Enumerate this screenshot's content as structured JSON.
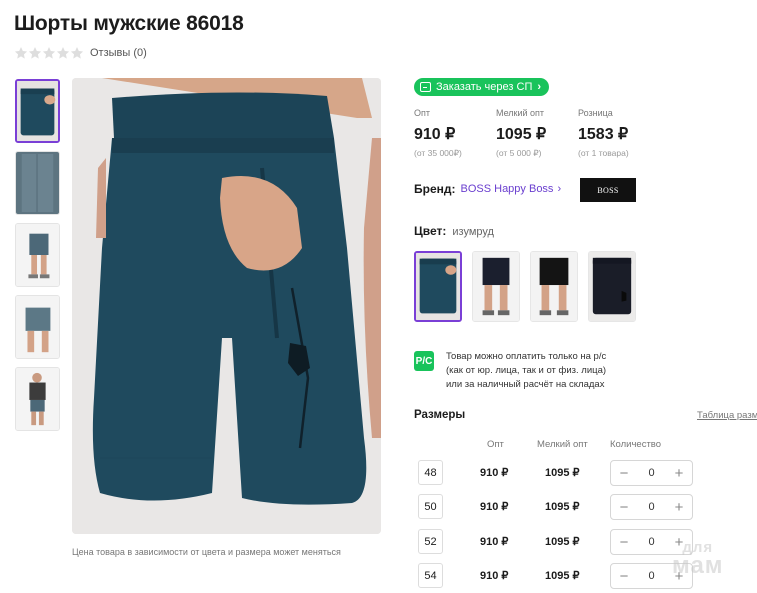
{
  "product": {
    "title": "Шорты мужские 86018",
    "reviews_label": "Отзывы (0)",
    "rating_stars": 0,
    "photo_note": "Цена товара в зависимости от цвета и размера может меняться"
  },
  "order_button": {
    "label": "Заказать через СП"
  },
  "prices": [
    {
      "label": "Опт",
      "value": "910 ₽",
      "min": "(от 35 000₽)"
    },
    {
      "label": "Мелкий опт",
      "value": "1095 ₽",
      "min": "(от 5 000 ₽)"
    },
    {
      "label": "Розница",
      "value": "1583 ₽",
      "min": "(от 1 товара)"
    }
  ],
  "brand": {
    "label": "Бренд:",
    "name": "BOSS Happy Boss",
    "logo_text": "BOSS"
  },
  "color": {
    "label": "Цвет:",
    "value": "изумруд"
  },
  "payment_note": {
    "icon_text": "Р/С",
    "lines": [
      "Товар можно оплатить только на р/с",
      "(как от юр. лица, так и от физ. лица)",
      "или за наличный расчёт на складах"
    ]
  },
  "sizes": {
    "title": "Размеры",
    "table_link": "Таблица разм",
    "headers": {
      "opt": "Опт",
      "small_opt": "Мелкий опт",
      "qty": "Количество"
    },
    "rows": [
      {
        "size": "48",
        "opt": "910 ₽",
        "small_opt": "1095 ₽",
        "qty": "0"
      },
      {
        "size": "50",
        "opt": "910 ₽",
        "small_opt": "1095 ₽",
        "qty": "0"
      },
      {
        "size": "52",
        "opt": "910 ₽",
        "small_opt": "1095 ₽",
        "qty": "0"
      },
      {
        "size": "54",
        "opt": "910 ₽",
        "small_opt": "1095 ₽",
        "qty": "0"
      }
    ],
    "minus": "−",
    "plus": "+"
  },
  "watermark": {
    "line1": "для",
    "line2": "мам"
  },
  "colors": {
    "accent": "#7a3fd6",
    "green": "#19c35b",
    "shorts": "#1f4a5e"
  }
}
